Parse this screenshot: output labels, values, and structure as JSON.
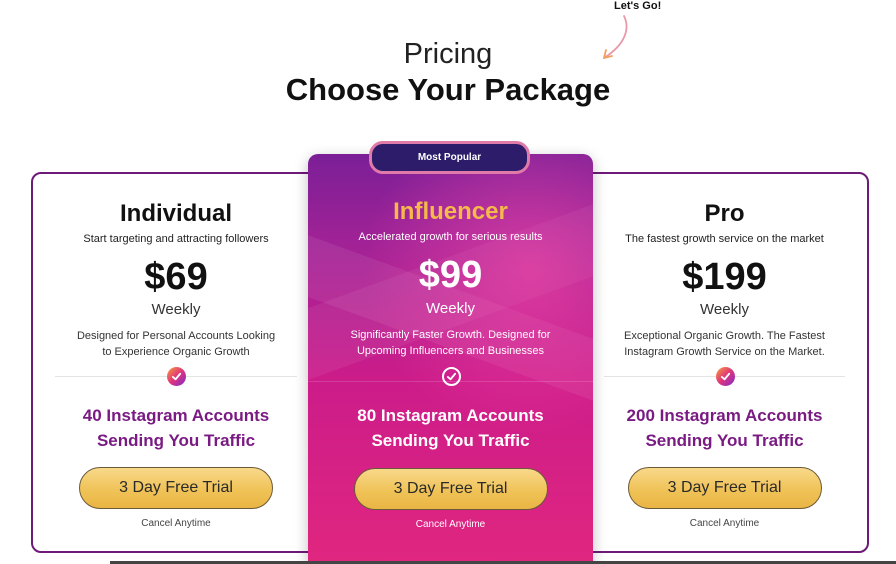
{
  "header": {
    "lets_go": "Let's Go!",
    "title_small": "Pricing",
    "title_big": "Choose Your Package"
  },
  "badge": "Most Popular",
  "plans": [
    {
      "name": "Individual",
      "tagline": "Start targeting and attracting followers",
      "price": "$69",
      "period": "Weekly",
      "desc_line1": "Designed for Personal Accounts Looking",
      "desc_line2": "to Experience Organic Growth",
      "accounts_line1": "40 Instagram Accounts",
      "accounts_line2": "Sending You Traffic",
      "cta": "3 Day Free Trial",
      "cancel": "Cancel Anytime"
    },
    {
      "name": "Influencer",
      "tagline": "Accelerated growth for serious results",
      "price": "$99",
      "period": "Weekly",
      "desc_line1": "Significantly Faster Growth. Designed for",
      "desc_line2": "Upcoming Influencers and Businesses",
      "accounts_line1": "80 Instagram Accounts",
      "accounts_line2": "Sending You Traffic",
      "cta": "3 Day Free Trial",
      "cancel": "Cancel Anytime"
    },
    {
      "name": "Pro",
      "tagline": "The fastest growth service on the market",
      "price": "$199",
      "period": "Weekly",
      "desc_line1": "Exceptional Organic Growth. The Fastest",
      "desc_line2": "Instagram Growth Service on the Market.",
      "accounts_line1": "200 Instagram Accounts",
      "accounts_line2": "Sending You Traffic",
      "cta": "3 Day Free Trial",
      "cancel": "Cancel Anytime"
    }
  ],
  "colors": {
    "accent_purple": "#7a1b83",
    "featured_name": "#f5b84a",
    "cta_gold": "#f0c358",
    "badge_bg": "#2c1c6a"
  },
  "icons": {
    "check": "check-circle-icon",
    "arrow": "curved-arrow-icon"
  }
}
